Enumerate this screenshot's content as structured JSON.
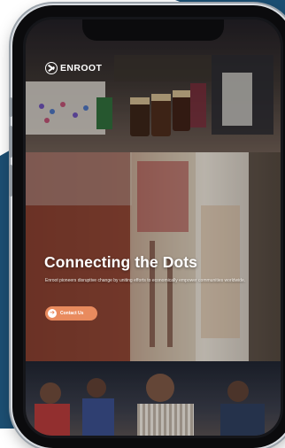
{
  "brand": {
    "name": "ENROOT",
    "logo_icon": "enroot-logo-icon"
  },
  "hero": {
    "title": "Connecting the Dots",
    "description": "Enroot pioneers disruptive change by uniting efforts to economically empower communities worldwide.",
    "cta_label": "Contact Us",
    "cta_icon": "arrow-right-circle-icon"
  },
  "colors": {
    "accent": "#e98b5e",
    "background_shape": "#1c4f73",
    "text": "#ffffff"
  }
}
